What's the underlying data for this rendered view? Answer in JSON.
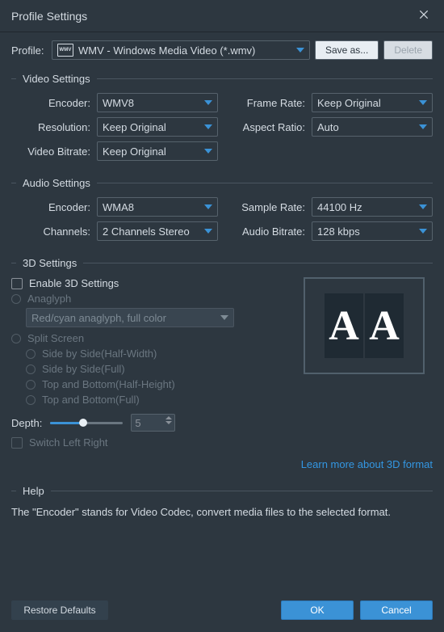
{
  "title": "Profile Settings",
  "profile_label": "Profile:",
  "profile_value": "WMV - Windows Media Video (*.wmv)",
  "saveas_label": "Save as...",
  "delete_label": "Delete",
  "video": {
    "header": "Video Settings",
    "encoder_label": "Encoder:",
    "encoder_value": "WMV8",
    "resolution_label": "Resolution:",
    "resolution_value": "Keep Original",
    "bitrate_label": "Video Bitrate:",
    "bitrate_value": "Keep Original",
    "framerate_label": "Frame Rate:",
    "framerate_value": "Keep Original",
    "aspect_label": "Aspect Ratio:",
    "aspect_value": "Auto"
  },
  "audio": {
    "header": "Audio Settings",
    "encoder_label": "Encoder:",
    "encoder_value": "WMA8",
    "channels_label": "Channels:",
    "channels_value": "2 Channels Stereo",
    "samplerate_label": "Sample Rate:",
    "samplerate_value": "44100 Hz",
    "bitrate_label": "Audio Bitrate:",
    "bitrate_value": "128 kbps"
  },
  "threed": {
    "header": "3D Settings",
    "enable_label": "Enable 3D Settings",
    "anaglyph_label": "Anaglyph",
    "anaglyph_value": "Red/cyan anaglyph, full color",
    "split_label": "Split Screen",
    "opt1": "Side by Side(Half-Width)",
    "opt2": "Side by Side(Full)",
    "opt3": "Top and Bottom(Half-Height)",
    "opt4": "Top and Bottom(Full)",
    "depth_label": "Depth:",
    "depth_value": "5",
    "switch_label": "Switch Left Right",
    "link_label": "Learn more about 3D format",
    "preview_letter": "A"
  },
  "help": {
    "header": "Help",
    "text": "The \"Encoder\" stands for Video Codec, convert media files to the selected format."
  },
  "footer": {
    "restore": "Restore Defaults",
    "ok": "OK",
    "cancel": "Cancel"
  }
}
